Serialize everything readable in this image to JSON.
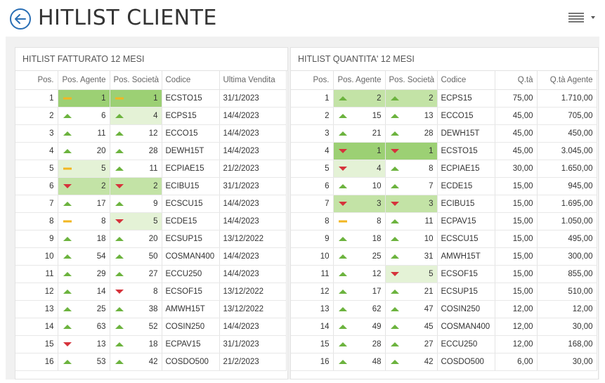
{
  "header": {
    "title": "HITLIST CLIENTE"
  },
  "left_table": {
    "title": "HITLIST FATTURATO 12 MESI",
    "columns": [
      "Pos.",
      "Pos. Agente",
      "Pos. Società",
      "Codice",
      "Ultima Vendita"
    ],
    "rows": [
      {
        "pos": "1",
        "agent_trend": "eq",
        "agent": "1",
        "company_trend": "eq",
        "company": "1",
        "code": "ECSTO15",
        "date": "31/1/2023",
        "agent_hl": "strong",
        "company_hl": "strong"
      },
      {
        "pos": "2",
        "agent_trend": "up",
        "agent": "6",
        "company_trend": "up",
        "company": "4",
        "code": "ECPS15",
        "date": "14/4/2023",
        "agent_hl": "",
        "company_hl": "light"
      },
      {
        "pos": "3",
        "agent_trend": "up",
        "agent": "11",
        "company_trend": "up",
        "company": "12",
        "code": "ECCO15",
        "date": "14/4/2023",
        "agent_hl": "",
        "company_hl": ""
      },
      {
        "pos": "4",
        "agent_trend": "up",
        "agent": "20",
        "company_trend": "up",
        "company": "28",
        "code": "DEWH15T",
        "date": "14/4/2023",
        "agent_hl": "",
        "company_hl": ""
      },
      {
        "pos": "5",
        "agent_trend": "eq",
        "agent": "5",
        "company_trend": "up",
        "company": "11",
        "code": "ECPIAE15",
        "date": "21/2/2023",
        "agent_hl": "light",
        "company_hl": ""
      },
      {
        "pos": "6",
        "agent_trend": "down",
        "agent": "2",
        "company_trend": "down",
        "company": "2",
        "code": "ECIBU15",
        "date": "31/1/2023",
        "agent_hl": "mid",
        "company_hl": "mid"
      },
      {
        "pos": "7",
        "agent_trend": "up",
        "agent": "17",
        "company_trend": "up",
        "company": "9",
        "code": "ECSCU15",
        "date": "14/4/2023",
        "agent_hl": "",
        "company_hl": ""
      },
      {
        "pos": "8",
        "agent_trend": "eq",
        "agent": "8",
        "company_trend": "down",
        "company": "5",
        "code": "ECDE15",
        "date": "14/4/2023",
        "agent_hl": "",
        "company_hl": "light"
      },
      {
        "pos": "9",
        "agent_trend": "up",
        "agent": "18",
        "company_trend": "up",
        "company": "20",
        "code": "ECSUP15",
        "date": "13/12/2022",
        "agent_hl": "",
        "company_hl": ""
      },
      {
        "pos": "10",
        "agent_trend": "up",
        "agent": "54",
        "company_trend": "up",
        "company": "50",
        "code": "COSMAN400",
        "date": "14/4/2023",
        "agent_hl": "",
        "company_hl": ""
      },
      {
        "pos": "11",
        "agent_trend": "up",
        "agent": "29",
        "company_trend": "up",
        "company": "27",
        "code": "ECCU250",
        "date": "14/4/2023",
        "agent_hl": "",
        "company_hl": ""
      },
      {
        "pos": "12",
        "agent_trend": "up",
        "agent": "14",
        "company_trend": "down",
        "company": "8",
        "code": "ECSOF15",
        "date": "13/12/2022",
        "agent_hl": "",
        "company_hl": ""
      },
      {
        "pos": "13",
        "agent_trend": "up",
        "agent": "25",
        "company_trend": "up",
        "company": "38",
        "code": "AMWH15T",
        "date": "13/12/2022",
        "agent_hl": "",
        "company_hl": ""
      },
      {
        "pos": "14",
        "agent_trend": "up",
        "agent": "63",
        "company_trend": "up",
        "company": "52",
        "code": "COSIN250",
        "date": "14/4/2023",
        "agent_hl": "",
        "company_hl": ""
      },
      {
        "pos": "15",
        "agent_trend": "down",
        "agent": "13",
        "company_trend": "up",
        "company": "18",
        "code": "ECPAV15",
        "date": "31/1/2023",
        "agent_hl": "",
        "company_hl": ""
      },
      {
        "pos": "16",
        "agent_trend": "up",
        "agent": "53",
        "company_trend": "up",
        "company": "42",
        "code": "COSDO500",
        "date": "21/2/2023",
        "agent_hl": "",
        "company_hl": ""
      }
    ]
  },
  "right_table": {
    "title": "HITLIST QUANTITA' 12 MESI",
    "columns": [
      "Pos.",
      "Pos. Agente",
      "Pos. Società",
      "Codice",
      "Q.tà",
      "Q.tà Agente"
    ],
    "rows": [
      {
        "pos": "1",
        "agent_trend": "up",
        "agent": "2",
        "company_trend": "up",
        "company": "2",
        "code": "ECPS15",
        "qty": "75,00",
        "qty_agent": "1.710,00",
        "agent_hl": "mid",
        "company_hl": "mid"
      },
      {
        "pos": "2",
        "agent_trend": "up",
        "agent": "15",
        "company_trend": "up",
        "company": "13",
        "code": "ECCO15",
        "qty": "45,00",
        "qty_agent": "705,00",
        "agent_hl": "",
        "company_hl": ""
      },
      {
        "pos": "3",
        "agent_trend": "up",
        "agent": "21",
        "company_trend": "up",
        "company": "28",
        "code": "DEWH15T",
        "qty": "45,00",
        "qty_agent": "450,00",
        "agent_hl": "",
        "company_hl": ""
      },
      {
        "pos": "4",
        "agent_trend": "down",
        "agent": "1",
        "company_trend": "down",
        "company": "1",
        "code": "ECSTO15",
        "qty": "45,00",
        "qty_agent": "3.045,00",
        "agent_hl": "strong",
        "company_hl": "strong"
      },
      {
        "pos": "5",
        "agent_trend": "down",
        "agent": "4",
        "company_trend": "up",
        "company": "8",
        "code": "ECPIAE15",
        "qty": "30,00",
        "qty_agent": "1.650,00",
        "agent_hl": "light",
        "company_hl": ""
      },
      {
        "pos": "6",
        "agent_trend": "up",
        "agent": "10",
        "company_trend": "up",
        "company": "7",
        "code": "ECDE15",
        "qty": "15,00",
        "qty_agent": "945,00",
        "agent_hl": "",
        "company_hl": ""
      },
      {
        "pos": "7",
        "agent_trend": "down",
        "agent": "3",
        "company_trend": "down",
        "company": "3",
        "code": "ECIBU15",
        "qty": "15,00",
        "qty_agent": "1.695,00",
        "agent_hl": "mid",
        "company_hl": "mid"
      },
      {
        "pos": "8",
        "agent_trend": "eq",
        "agent": "8",
        "company_trend": "up",
        "company": "11",
        "code": "ECPAV15",
        "qty": "15,00",
        "qty_agent": "1.050,00",
        "agent_hl": "",
        "company_hl": ""
      },
      {
        "pos": "9",
        "agent_trend": "up",
        "agent": "18",
        "company_trend": "up",
        "company": "10",
        "code": "ECSCU15",
        "qty": "15,00",
        "qty_agent": "495,00",
        "agent_hl": "",
        "company_hl": ""
      },
      {
        "pos": "10",
        "agent_trend": "up",
        "agent": "25",
        "company_trend": "up",
        "company": "31",
        "code": "AMWH15T",
        "qty": "15,00",
        "qty_agent": "300,00",
        "agent_hl": "",
        "company_hl": ""
      },
      {
        "pos": "11",
        "agent_trend": "up",
        "agent": "12",
        "company_trend": "down",
        "company": "5",
        "code": "ECSOF15",
        "qty": "15,00",
        "qty_agent": "855,00",
        "agent_hl": "",
        "company_hl": "light"
      },
      {
        "pos": "12",
        "agent_trend": "up",
        "agent": "17",
        "company_trend": "up",
        "company": "21",
        "code": "ECSUP15",
        "qty": "15,00",
        "qty_agent": "510,00",
        "agent_hl": "",
        "company_hl": ""
      },
      {
        "pos": "13",
        "agent_trend": "up",
        "agent": "62",
        "company_trend": "up",
        "company": "47",
        "code": "COSIN250",
        "qty": "12,00",
        "qty_agent": "12,00",
        "agent_hl": "",
        "company_hl": ""
      },
      {
        "pos": "14",
        "agent_trend": "up",
        "agent": "49",
        "company_trend": "up",
        "company": "45",
        "code": "COSMAN400",
        "qty": "12,00",
        "qty_agent": "30,00",
        "agent_hl": "",
        "company_hl": ""
      },
      {
        "pos": "15",
        "agent_trend": "up",
        "agent": "28",
        "company_trend": "up",
        "company": "27",
        "code": "ECCU250",
        "qty": "12,00",
        "qty_agent": "168,00",
        "agent_hl": "",
        "company_hl": ""
      },
      {
        "pos": "16",
        "agent_trend": "up",
        "agent": "48",
        "company_trend": "up",
        "company": "42",
        "code": "COSDO500",
        "qty": "6,00",
        "qty_agent": "30,00",
        "agent_hl": "",
        "company_hl": ""
      }
    ]
  },
  "colors": {
    "accent": "#2a6fb5",
    "trend_up": "#6cb33e",
    "trend_down": "#d6333b",
    "trend_equal": "#f2b621"
  }
}
